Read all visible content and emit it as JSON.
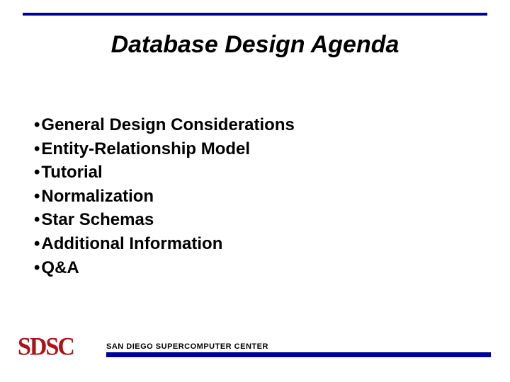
{
  "title": "Database Design Agenda",
  "bullets": [
    "General Design Considerations",
    "Entity-Relationship Model",
    "Tutorial",
    "Normalization",
    "Star Schemas",
    "Additional Information",
    "Q&A"
  ],
  "footer": {
    "logo": "SDSC",
    "org": "SAN DIEGO SUPERCOMPUTER CENTER"
  }
}
